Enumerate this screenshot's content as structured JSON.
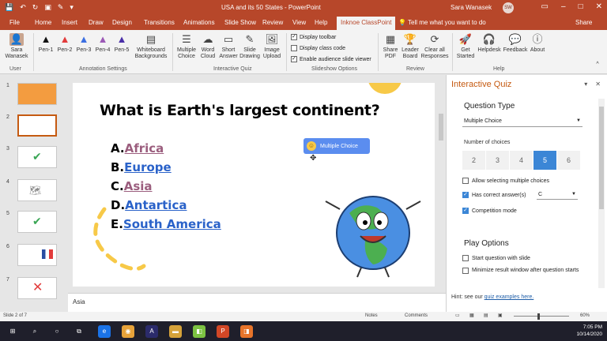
{
  "window": {
    "title": "USA and its 50 States  -  PowerPoint",
    "user": "Sara Wanasek",
    "initials": "SW"
  },
  "tabs": [
    "File",
    "Home",
    "Insert",
    "Draw",
    "Design",
    "Transitions",
    "Animations",
    "Slide Show",
    "Review",
    "View",
    "Help",
    "Inknoe ClassPoint"
  ],
  "tab_active": "Inknoe ClassPoint",
  "tell_me": "Tell me what you want to do",
  "share": "Share",
  "ribbon": {
    "user_name": "Sara Wanasek",
    "user_group": "User",
    "pens": [
      "Pen-1",
      "Pen-2",
      "Pen-3",
      "Pen-4",
      "Pen-5"
    ],
    "pen_colors": [
      "#111111",
      "#e23b3b",
      "#3b6fe2",
      "#9b59b6",
      "#4a2fa8"
    ],
    "whiteboard": "Whiteboard Backgrounds",
    "annotation_group": "Annotation Settings",
    "quiz_buttons": [
      "Multiple Choice",
      "Word Cloud",
      "Short Answer",
      "Slide Drawing",
      "Image Upload"
    ],
    "quiz_group": "Interactive Quiz",
    "slideshow_options": [
      "Display toolbar",
      "Display class code",
      "Enable audience slide viewer"
    ],
    "slideshow_group": "Slideshow Options",
    "review_buttons": [
      "Share PDF",
      "Leader Board",
      "Clear all Responses"
    ],
    "review_group": "Review",
    "help_buttons": [
      "Get Started",
      "Helpdesk",
      "Feedback",
      "About"
    ],
    "help_group": "Help"
  },
  "thumbnails": [
    "1",
    "2",
    "3",
    "4",
    "5",
    "6",
    "7"
  ],
  "slide": {
    "question": "What is Earth's largest continent?",
    "options": [
      {
        "letter": "A.",
        "text": "Africa"
      },
      {
        "letter": "B.",
        "text": "Europe"
      },
      {
        "letter": "C.",
        "text": "Asia"
      },
      {
        "letter": "D.",
        "text": "Antartica"
      },
      {
        "letter": "E.",
        "text": "South America"
      }
    ],
    "badge": "Multiple Choice"
  },
  "notes_text": "Asia",
  "panel": {
    "title": "Interactive Quiz",
    "question_type_heading": "Question Type",
    "question_type_value": "Multiple Choice",
    "num_choices_label": "Number of choices",
    "choices": [
      "2",
      "3",
      "4",
      "5",
      "6"
    ],
    "selected_choice": "5",
    "allow_multiple": "Allow selecting multiple choices",
    "has_correct": "Has correct answer(s)",
    "correct_value": "C",
    "competition": "Competition mode",
    "play_options_heading": "Play Options",
    "start_with_slide": "Start question with slide",
    "minimize_result": "Minimize result window after question starts",
    "hint_prefix": "Hint: see our ",
    "hint_link": "quiz examples here."
  },
  "status": {
    "slide_of": "Slide 2 of 7",
    "notes": "Notes",
    "comments": "Comments",
    "zoom": "60%"
  },
  "taskbar": {
    "time": "7:05 PM",
    "date": "10/14/2020"
  }
}
